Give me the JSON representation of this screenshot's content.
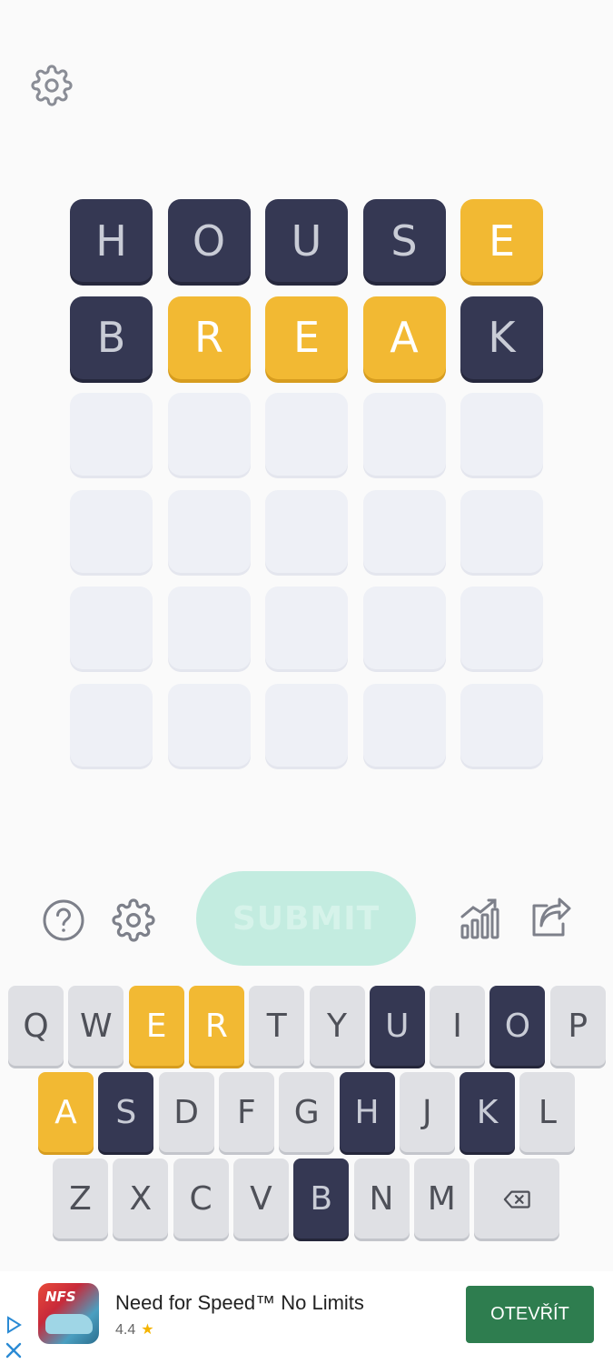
{
  "board": {
    "rows": [
      [
        {
          "letter": "H",
          "state": "absent"
        },
        {
          "letter": "O",
          "state": "absent"
        },
        {
          "letter": "U",
          "state": "absent"
        },
        {
          "letter": "S",
          "state": "absent"
        },
        {
          "letter": "E",
          "state": "present"
        }
      ],
      [
        {
          "letter": "B",
          "state": "absent"
        },
        {
          "letter": "R",
          "state": "present"
        },
        {
          "letter": "E",
          "state": "present"
        },
        {
          "letter": "A",
          "state": "present"
        },
        {
          "letter": "K",
          "state": "absent"
        }
      ],
      [
        {
          "letter": "",
          "state": "empty"
        },
        {
          "letter": "",
          "state": "empty"
        },
        {
          "letter": "",
          "state": "empty"
        },
        {
          "letter": "",
          "state": "empty"
        },
        {
          "letter": "",
          "state": "empty"
        }
      ],
      [
        {
          "letter": "",
          "state": "empty"
        },
        {
          "letter": "",
          "state": "empty"
        },
        {
          "letter": "",
          "state": "empty"
        },
        {
          "letter": "",
          "state": "empty"
        },
        {
          "letter": "",
          "state": "empty"
        }
      ],
      [
        {
          "letter": "",
          "state": "empty"
        },
        {
          "letter": "",
          "state": "empty"
        },
        {
          "letter": "",
          "state": "empty"
        },
        {
          "letter": "",
          "state": "empty"
        },
        {
          "letter": "",
          "state": "empty"
        }
      ],
      [
        {
          "letter": "",
          "state": "empty"
        },
        {
          "letter": "",
          "state": "empty"
        },
        {
          "letter": "",
          "state": "empty"
        },
        {
          "letter": "",
          "state": "empty"
        },
        {
          "letter": "",
          "state": "empty"
        }
      ]
    ]
  },
  "toolbar": {
    "help_icon": "question-circle-icon",
    "settings_icon": "gear-icon",
    "submit_label": "SUBMIT",
    "stats_icon": "bar-chart-icon",
    "share_icon": "share-icon"
  },
  "keyboard": {
    "rows": [
      [
        {
          "key": "Q",
          "state": "unused"
        },
        {
          "key": "W",
          "state": "unused"
        },
        {
          "key": "E",
          "state": "present"
        },
        {
          "key": "R",
          "state": "present"
        },
        {
          "key": "T",
          "state": "unused"
        },
        {
          "key": "Y",
          "state": "unused"
        },
        {
          "key": "U",
          "state": "absent"
        },
        {
          "key": "I",
          "state": "unused"
        },
        {
          "key": "O",
          "state": "absent"
        },
        {
          "key": "P",
          "state": "unused"
        }
      ],
      [
        {
          "key": "A",
          "state": "present"
        },
        {
          "key": "S",
          "state": "absent"
        },
        {
          "key": "D",
          "state": "unused"
        },
        {
          "key": "F",
          "state": "unused"
        },
        {
          "key": "G",
          "state": "unused"
        },
        {
          "key": "H",
          "state": "absent"
        },
        {
          "key": "J",
          "state": "unused"
        },
        {
          "key": "K",
          "state": "absent"
        },
        {
          "key": "L",
          "state": "unused"
        }
      ],
      [
        {
          "key": "Z",
          "state": "unused"
        },
        {
          "key": "X",
          "state": "unused"
        },
        {
          "key": "C",
          "state": "unused"
        },
        {
          "key": "V",
          "state": "unused"
        },
        {
          "key": "B",
          "state": "absent"
        },
        {
          "key": "N",
          "state": "unused"
        },
        {
          "key": "M",
          "state": "unused"
        }
      ]
    ],
    "backspace_icon": "backspace-icon"
  },
  "ad": {
    "icon_text": "NFS",
    "title": "Need for Speed™ No Limits",
    "rating": "4.4",
    "cta": "OTEVŘÍT"
  },
  "colors": {
    "absent": "#353853",
    "present": "#f2b933",
    "empty": "#eef0f6",
    "key_unused": "#dfe0e4",
    "submit_disabled": "#c3ece0",
    "ad_cta": "#2e7d4f"
  }
}
